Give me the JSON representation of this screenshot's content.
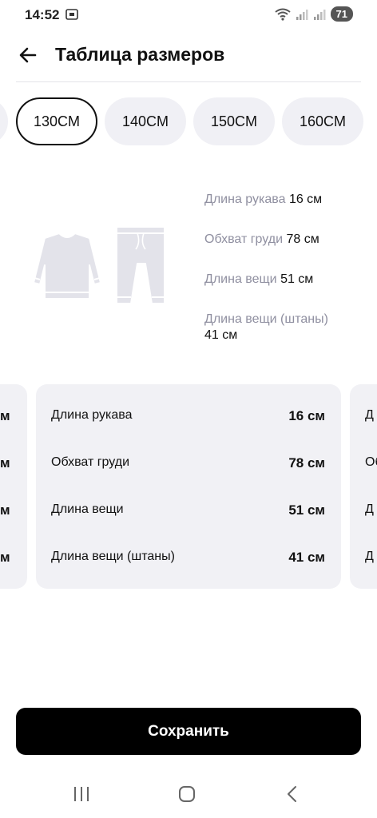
{
  "status": {
    "time": "14:52",
    "battery": "71"
  },
  "header": {
    "title": "Таблица размеров"
  },
  "size_tabs": [
    {
      "label": "130CM",
      "selected": true
    },
    {
      "label": "140CM",
      "selected": false
    },
    {
      "label": "150CM",
      "selected": false
    },
    {
      "label": "160CM",
      "selected": false
    }
  ],
  "summary": [
    {
      "label": "Длина рукава",
      "value": "16 см"
    },
    {
      "label": "Обхват груди",
      "value": "78 см"
    },
    {
      "label": "Длина вещи",
      "value": "51 см"
    },
    {
      "label": "Длина вещи (штаны)",
      "value": "41 см"
    }
  ],
  "card": {
    "rows": [
      {
        "label": "Длина рукава",
        "value": "16 см"
      },
      {
        "label": "Обхват груди",
        "value": "78 см"
      },
      {
        "label": "Длина вещи",
        "value": "51 см"
      },
      {
        "label": "Длина вещи (штаны)",
        "value": "41 см"
      }
    ]
  },
  "prev_card_stubs": [
    "м",
    "м",
    "м",
    "м"
  ],
  "next_card_stubs": [
    "Д",
    "Об",
    "Д",
    "Д"
  ],
  "save_button": {
    "label": "Сохранить"
  },
  "icons": {
    "back": "arrow-left-icon",
    "illustration": "sweatshirt-and-pants-icon",
    "nav": [
      "recent-apps-icon",
      "home-icon",
      "back-nav-icon"
    ]
  },
  "colors": {
    "accent": "#000000",
    "chip_bg": "#f0f0f5",
    "card_bg": "#f1f1f5",
    "muted_label": "#8f8fa0"
  }
}
